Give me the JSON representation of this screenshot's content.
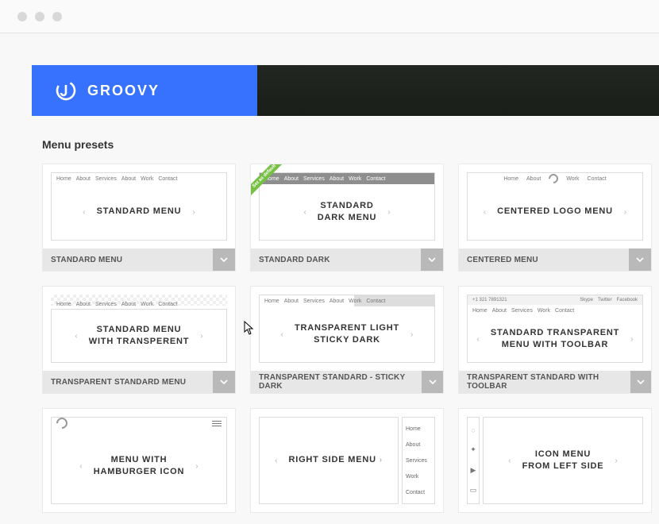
{
  "brand": {
    "name": "GROOVY"
  },
  "section_title": "Menu presets",
  "default_ribbon": "Set as default",
  "nav_items": [
    "Home",
    "About",
    "Services",
    "About",
    "Work",
    "Contact"
  ],
  "nav5": [
    "Home",
    "About",
    "Services",
    "Work",
    "Contact"
  ],
  "nav_center": {
    "left": [
      "Home",
      "About"
    ],
    "right": [
      "Work",
      "Contact"
    ]
  },
  "toolbar": {
    "phone": "+1 321 7891321",
    "links": [
      "Skype",
      "Twitter",
      "Facebook"
    ]
  },
  "arrows": {
    "left": "‹",
    "right": "›"
  },
  "presets": [
    {
      "id": "standard-menu",
      "title_line1": "STANDARD MENU",
      "title_line2": "",
      "caption": "STANDARD MENU",
      "has_caption": true,
      "variant": "light",
      "default": false
    },
    {
      "id": "standard-dark",
      "title_line1": "STANDARD",
      "title_line2": "DARK MENU",
      "caption": "STANDARD DARK",
      "has_caption": true,
      "variant": "dark",
      "default": true
    },
    {
      "id": "centered-logo-menu",
      "title_line1": "CENTERED LOGO MENU",
      "title_line2": "",
      "caption": "CENTERED MENU",
      "has_caption": true,
      "variant": "center",
      "default": false
    },
    {
      "id": "transparent-standard",
      "title_line1": "STANDARD MENU",
      "title_line2": "WITH TRANSPERENT",
      "caption": "TRANSPARENT STANDARD MENU",
      "has_caption": true,
      "variant": "transparent",
      "default": false
    },
    {
      "id": "transparent-sticky-dark",
      "title_line1": "TRANSPARENT LIGHT",
      "title_line2": "STICKY DARK",
      "caption": "TRANSPARENT STANDARD - STICKY DARK",
      "has_caption": true,
      "variant": "sticky-dark",
      "default": false
    },
    {
      "id": "transparent-toolbar",
      "title_line1": "STANDARD TRANSPARENT",
      "title_line2": "MENU WITH TOOLBAR",
      "caption": "TRANSPARENT STANDARD WITH TOOLBAR",
      "has_caption": true,
      "variant": "toolbar",
      "default": false
    },
    {
      "id": "hamburger",
      "title_line1": "MENU WITH",
      "title_line2": "HAMBURGER ICON",
      "caption": "",
      "has_caption": false,
      "variant": "hamburger",
      "default": false
    },
    {
      "id": "right-side",
      "title_line1": "RIGHT SIDE MENU",
      "title_line2": "",
      "caption": "",
      "has_caption": false,
      "variant": "right-side",
      "default": false
    },
    {
      "id": "icon-left",
      "title_line1": "ICON MENU",
      "title_line2": "FROM LEFT SIDE",
      "caption": "",
      "has_caption": false,
      "variant": "icon-left",
      "default": false
    }
  ]
}
